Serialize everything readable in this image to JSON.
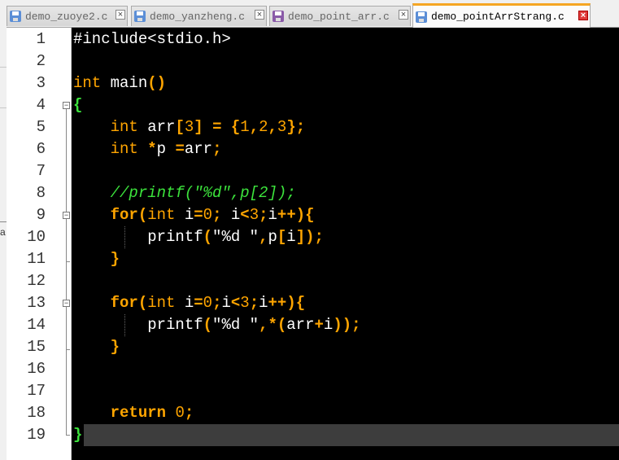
{
  "tabs": [
    {
      "label": "demo_zuoye2.c",
      "active": false,
      "icon": "save-disk-icon",
      "icon_color": "#5b8ed6"
    },
    {
      "label": "demo_yanzheng.c",
      "active": false,
      "icon": "save-disk-icon",
      "icon_color": "#5b8ed6"
    },
    {
      "label": "demo_point_arr.c",
      "active": false,
      "icon": "save-disk-icon",
      "icon_color": "#8a5aa8"
    },
    {
      "label": "demo_pointArrStrang.c",
      "active": true,
      "icon": "save-disk-icon",
      "icon_color": "#5b8ed6"
    }
  ],
  "close_glyph": "×",
  "sliver_char": "a",
  "fold_markers": {
    "open": "−"
  },
  "editor": {
    "line_numbers": [
      "1",
      "2",
      "3",
      "4",
      "5",
      "6",
      "7",
      "8",
      "9",
      "10",
      "11",
      "12",
      "13",
      "14",
      "15",
      "16",
      "17",
      "18",
      "19"
    ],
    "current_line": 19,
    "code": {
      "l1": {
        "text": "#include<stdio.h>"
      },
      "l3": {
        "t1": "int",
        "t2": " main",
        "t3": "()"
      },
      "l4": {
        "t1": "{"
      },
      "l5": {
        "t1": "    ",
        "t2": "int",
        "t3": " arr",
        "t4": "[",
        "t5": "3",
        "t6": "]",
        "t7": " ",
        "t8": "=",
        "t9": " ",
        "t10": "{",
        "t11": "1",
        "t12": ",",
        "t13": "2",
        "t14": ",",
        "t15": "3",
        "t16": "};"
      },
      "l6": {
        "t1": "    ",
        "t2": "int",
        "t3": " ",
        "t4": "*",
        "t5": "p ",
        "t6": "=",
        "t7": "arr",
        "t8": ";"
      },
      "l8": {
        "t1": "    ",
        "t2": "//printf(\"%d\",p[2]);"
      },
      "l9": {
        "t1": "    ",
        "t2": "for",
        "t3": "(",
        "t4": "int",
        "t5": " i",
        "t6": "=",
        "t7": "0",
        "t8": ";",
        "t9": " i",
        "t10": "<",
        "t11": "3",
        "t12": ";",
        "t13": "i",
        "t14": "++",
        "t15": "){"
      },
      "l10": {
        "t1": "        ",
        "t2": "printf",
        "t3": "(",
        "t4": "\"%d \"",
        "t5": ",",
        "t6": "p",
        "t7": "[",
        "t8": "i",
        "t9": "]);"
      },
      "l11": {
        "t1": "    ",
        "t2": "}"
      },
      "l13": {
        "t1": "    ",
        "t2": "for",
        "t3": "(",
        "t4": "int",
        "t5": " i",
        "t6": "=",
        "t7": "0",
        "t8": ";",
        "t9": "i",
        "t10": "<",
        "t11": "3",
        "t12": ";",
        "t13": "i",
        "t14": "++",
        "t15": "){"
      },
      "l14": {
        "t1": "        ",
        "t2": "printf",
        "t3": "(",
        "t4": "\"%d \"",
        "t5": ",",
        "t6": "*",
        "t7": "(",
        "t8": "arr",
        "t9": "+",
        "t10": "i",
        "t11": "));"
      },
      "l15": {
        "t1": "    ",
        "t2": "}"
      },
      "l18": {
        "t1": "    ",
        "t2": "return",
        "t3": " ",
        "t4": "0",
        "t5": ";"
      },
      "l19": {
        "t1": "}"
      }
    }
  }
}
